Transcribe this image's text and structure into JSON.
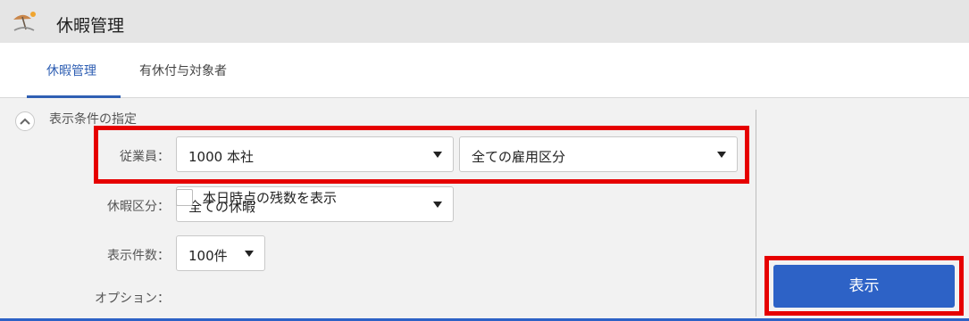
{
  "header": {
    "title": "休暇管理",
    "icon": "beach-umbrella-icon"
  },
  "tabs": [
    {
      "label": "休暇管理",
      "active": true
    },
    {
      "label": "有休付与対象者",
      "active": false
    }
  ],
  "filter": {
    "section_title": "表示条件の指定",
    "employee": {
      "label": "従業員：",
      "office": "1000 本社",
      "employment_type": "全ての雇用区分"
    },
    "leave_type": {
      "label": "休暇区分：",
      "value": "全ての休暇"
    },
    "count": {
      "label": "表示件数：",
      "value": "100件"
    },
    "option": {
      "label": "オプション：",
      "checkbox_label": "本日時点の残数を表示",
      "checked": false
    }
  },
  "actions": {
    "display_button": "表示"
  },
  "colors": {
    "accent": "#2d62c6",
    "highlight": "#e60000",
    "tab_active": "#2f5fb3"
  }
}
